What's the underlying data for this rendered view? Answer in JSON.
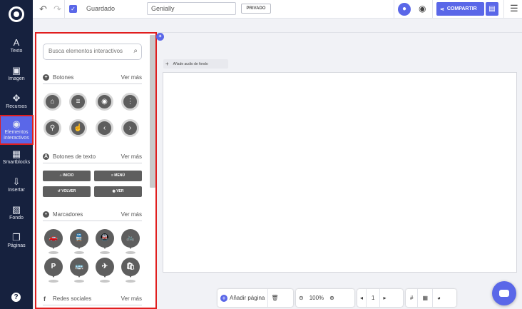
{
  "rail": {
    "items": [
      {
        "icon": "A",
        "label": "Texto"
      },
      {
        "icon": "▣",
        "label": "Imagen"
      },
      {
        "icon": "✥",
        "label": "Recursos"
      },
      {
        "icon": "◉",
        "label": "Elementos interactivos"
      },
      {
        "icon": "▦",
        "label": "Smartblocks"
      },
      {
        "icon": "⇩",
        "label": "Insertar"
      },
      {
        "icon": "▨",
        "label": "Fondo"
      },
      {
        "icon": "❐",
        "label": "Páginas"
      }
    ],
    "help": "?"
  },
  "topbar": {
    "undo": "↶",
    "redo": "↷",
    "saved": "Guardado",
    "title_value": "Genially",
    "privacy": "PRIVADO",
    "share": "COMPARTIR",
    "menu": "☰"
  },
  "panel": {
    "search_placeholder": "Busca elementos interactivos",
    "sections": {
      "buttons": {
        "title": "Botones",
        "more": "Ver más"
      },
      "text_buttons": {
        "title": "Botones de texto",
        "more": "Ver más"
      },
      "markers": {
        "title": "Marcadores",
        "more": "Ver más"
      },
      "social": {
        "title": "Redes sociales",
        "more": "Ver más"
      }
    },
    "icon_buttons": [
      "⌂",
      "≡",
      "◉",
      "⋮",
      "⚲",
      "☝",
      "‹",
      "›"
    ],
    "text_buttons": [
      "⌂ INICIO",
      "≡ MENÚ",
      "↺ VOLVER",
      "◉ VER"
    ],
    "markers": [
      "🚗",
      "🚆",
      "🚇",
      "🚲",
      "P",
      "🚌",
      "✈",
      "🛍"
    ]
  },
  "canvas": {
    "audio_plus": "+",
    "audio_label": "Añade audio de fondo"
  },
  "bottombar": {
    "add_page": "Añadir página",
    "zoom": "100%",
    "page": "1"
  },
  "colors": {
    "accent": "#5a67e8",
    "rail": "#16213e",
    "highlight": "#e01e1e"
  }
}
